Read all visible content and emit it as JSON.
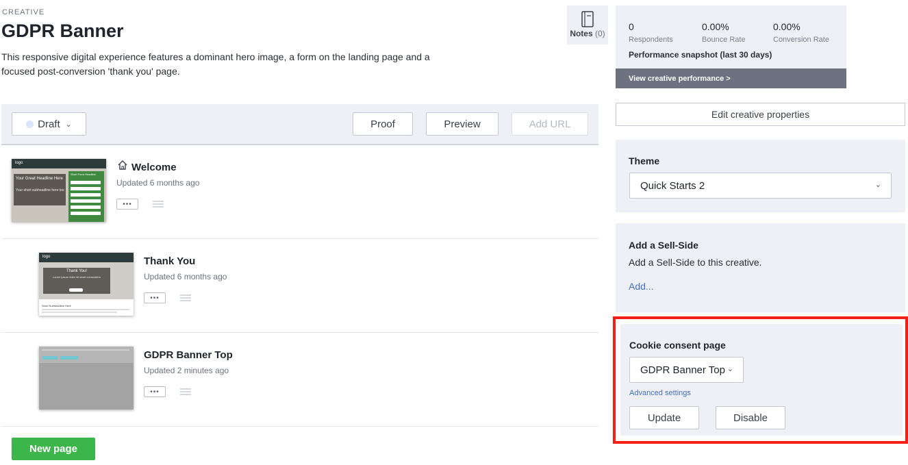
{
  "header": {
    "eyebrow": "CREATIVE",
    "title": "GDPR Banner",
    "description": "This responsive digital experience features a dominant hero image, a form on the landing page and a focused post-conversion 'thank you' page."
  },
  "notes": {
    "label": "Notes",
    "count": "(0)"
  },
  "toolbar": {
    "status_label": "Draft",
    "proof_label": "Proof",
    "preview_label": "Preview",
    "add_url_label": "Add URL"
  },
  "pages": [
    {
      "name": "Welcome",
      "updated": "Updated 6 months ago",
      "more": "•••",
      "thumb": {
        "logo": "logo",
        "headline": "Your Great Headline Here",
        "sub": "Your short subheadline here too",
        "form_title": "Short Form Headline"
      }
    },
    {
      "name": "Thank You",
      "updated": "Updated 6 months ago",
      "more": "•••",
      "thumb": {
        "logo": "logo",
        "headline": "Thank You!",
        "sub": "Lorem ipsum dolor sit amet consectetur",
        "lower": "Short Subheadline Here"
      }
    },
    {
      "name": "GDPR Banner Top",
      "updated": "Updated 2 minutes ago",
      "more": "•••"
    }
  ],
  "new_page_label": "New page",
  "performance": {
    "respondents_value": "0",
    "respondents_label": "Respondents",
    "bounce_value": "0.00%",
    "bounce_label": "Bounce Rate",
    "conversion_value": "0.00%",
    "conversion_label": "Conversion Rate",
    "snapshot": "Performance snapshot (last 30 days)",
    "view_link": "View creative performance >"
  },
  "edit_properties_label": "Edit creative properties",
  "theme": {
    "heading": "Theme",
    "selected": "Quick Starts 2"
  },
  "sell_side": {
    "heading": "Add a Sell-Side",
    "text": "Add a Sell-Side to this creative.",
    "link": "Add..."
  },
  "cookie": {
    "heading": "Cookie consent page",
    "selected": "GDPR Banner Top",
    "advanced": "Advanced settings",
    "update_label": "Update",
    "disable_label": "Disable"
  },
  "colors": {
    "accent_green": "#3cb64a",
    "link_blue": "#4470c4",
    "highlight_red": "#f41f16",
    "panel_bg": "#eff0f5"
  }
}
